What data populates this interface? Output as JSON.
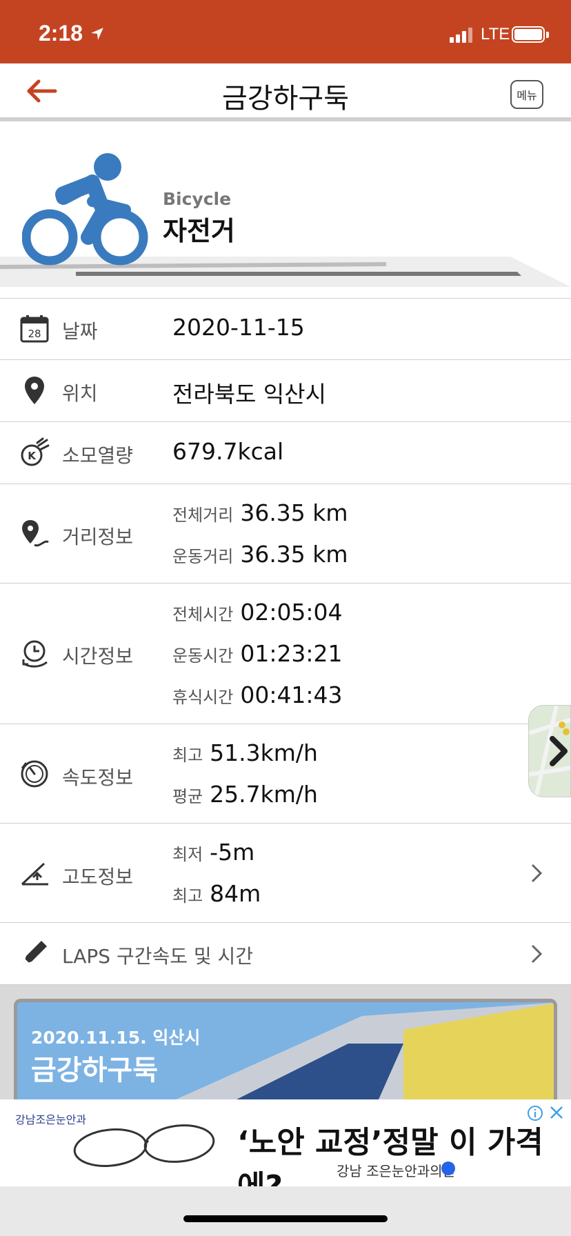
{
  "status_bar": {
    "time": "2:18",
    "network": "LTE",
    "battery_level": 1.0
  },
  "nav": {
    "title": "금강하구둑",
    "menu_label": "메뉴",
    "accent": "#c44422"
  },
  "activity": {
    "type_en": "Bicycle",
    "type_ko": "자전거",
    "icon": "bicycle-icon",
    "icon_color": "#3a7bbf"
  },
  "rows": {
    "date": {
      "label": "날짜",
      "value": "2020-11-15",
      "icon_text": "28"
    },
    "location": {
      "label": "위치",
      "value": "전라북도 익산시"
    },
    "calories": {
      "label": "소모열량",
      "value": "679.7kcal"
    },
    "distance": {
      "label": "거리정보",
      "items": [
        {
          "key": "전체거리",
          "value": "36.35 km"
        },
        {
          "key": "운동거리",
          "value": "36.35 km"
        }
      ]
    },
    "time": {
      "label": "시간정보",
      "items": [
        {
          "key": "전체시간",
          "value": "02:05:04"
        },
        {
          "key": "운동시간",
          "value": "01:23:21"
        },
        {
          "key": "휴식시간",
          "value": "00:41:43"
        }
      ]
    },
    "speed": {
      "label": "속도정보",
      "items": [
        {
          "key": "최고",
          "value": "51.3km/h"
        },
        {
          "key": "평균",
          "value": "25.7km/h"
        }
      ]
    },
    "altitude": {
      "label": "고도정보",
      "items": [
        {
          "key": "최저",
          "value": "-5m"
        },
        {
          "key": "최고",
          "value": "84m"
        }
      ]
    },
    "laps": {
      "label": "LAPS 구간속도 및 시간"
    }
  },
  "photo": {
    "date": "2020.11.15. 익산시",
    "title": "금강하구둑"
  },
  "ad": {
    "brand": "강남조은눈안과",
    "headline": "‘노안 교정’정말 이 가격에?",
    "sub": "강남 조은눈안과의원"
  }
}
